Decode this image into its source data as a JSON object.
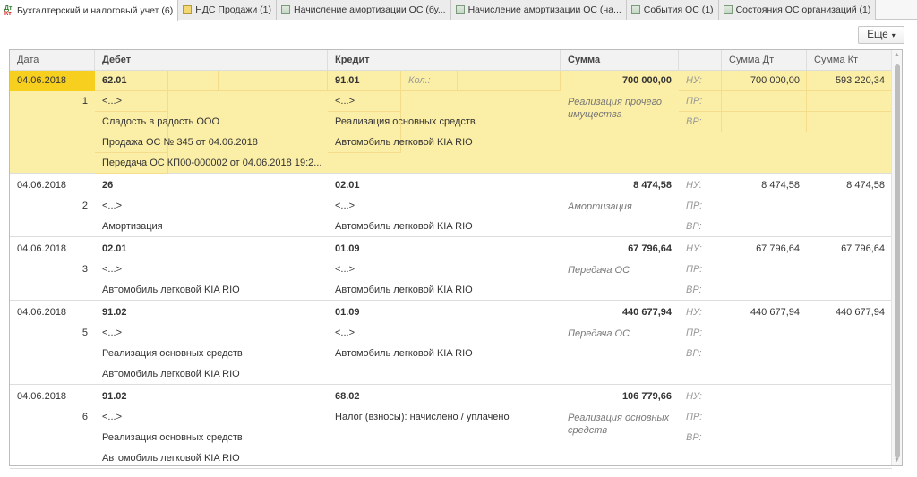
{
  "tabs": [
    {
      "label": "Бухгалтерский и налоговый учет (6)",
      "icon": "dt-kt-icon",
      "active": true
    },
    {
      "label": "НДС Продажи (1)",
      "icon": "document-icon"
    },
    {
      "label": "Начисление амортизации ОС (бу...",
      "icon": "table-icon"
    },
    {
      "label": "Начисление амортизации ОС (на...",
      "icon": "table-icon"
    },
    {
      "label": "События ОС (1)",
      "icon": "table-icon"
    },
    {
      "label": "Состояния ОС организаций (1)",
      "icon": "table-icon"
    }
  ],
  "more_label": "Еще",
  "columns": {
    "date": "Дата",
    "debit": "Дебет",
    "credit": "Кредит",
    "sum": "Сумма",
    "sum_dt": "Сумма Дт",
    "sum_kt": "Сумма Кт"
  },
  "labels": {
    "nu": "НУ:",
    "pr": "ПР:",
    "vr": "ВР:",
    "qty": "Кол.:"
  },
  "entries": [
    {
      "date": "04.06.2018",
      "num": "1",
      "debit": [
        "62.01",
        "<...>",
        "Сладость в радость ООО",
        "Продажа ОС № 345 от 04.06.2018",
        "Передача ОС КП00-000002 от 04.06.2018 19:2..."
      ],
      "credit": [
        "91.01",
        "<...>",
        "Реализация основных средств",
        "Автомобиль легковой KIA RIO"
      ],
      "sum": "700 000,00",
      "desc": "Реализация прочего имущества",
      "nu_dt": "700 000,00",
      "nu_kt": "593 220,34",
      "selected": true
    },
    {
      "date": "04.06.2018",
      "num": "2",
      "debit": [
        "26",
        "<...>",
        "Амортизация"
      ],
      "credit": [
        "02.01",
        "<...>",
        "Автомобиль легковой KIA RIO"
      ],
      "sum": "8 474,58",
      "desc": "Амортизация",
      "nu_dt": "8 474,58",
      "nu_kt": "8 474,58"
    },
    {
      "date": "04.06.2018",
      "num": "3",
      "debit": [
        "02.01",
        "<...>",
        "Автомобиль легковой KIA RIO"
      ],
      "credit": [
        "01.09",
        "<...>",
        "Автомобиль легковой KIA RIO"
      ],
      "sum": "67 796,64",
      "desc": "Передача ОС",
      "nu_dt": "67 796,64",
      "nu_kt": "67 796,64"
    },
    {
      "date": "04.06.2018",
      "num": "5",
      "debit": [
        "91.02",
        "<...>",
        "Реализация основных средств",
        "Автомобиль легковой KIA RIO"
      ],
      "credit": [
        "01.09",
        "<...>",
        "Автомобиль легковой KIA RIO"
      ],
      "sum": "440 677,94",
      "desc": "Передача ОС",
      "nu_dt": "440 677,94",
      "nu_kt": "440 677,94"
    },
    {
      "date": "04.06.2018",
      "num": "6",
      "debit": [
        "91.02",
        "<...>",
        "Реализация основных средств",
        "Автомобиль легковой KIA RIO"
      ],
      "credit": [
        "68.02",
        "Налог (взносы): начислено / уплачено"
      ],
      "sum": "106 779,66",
      "desc": "Реализация основных средств",
      "nu_dt": "",
      "nu_kt": ""
    }
  ]
}
